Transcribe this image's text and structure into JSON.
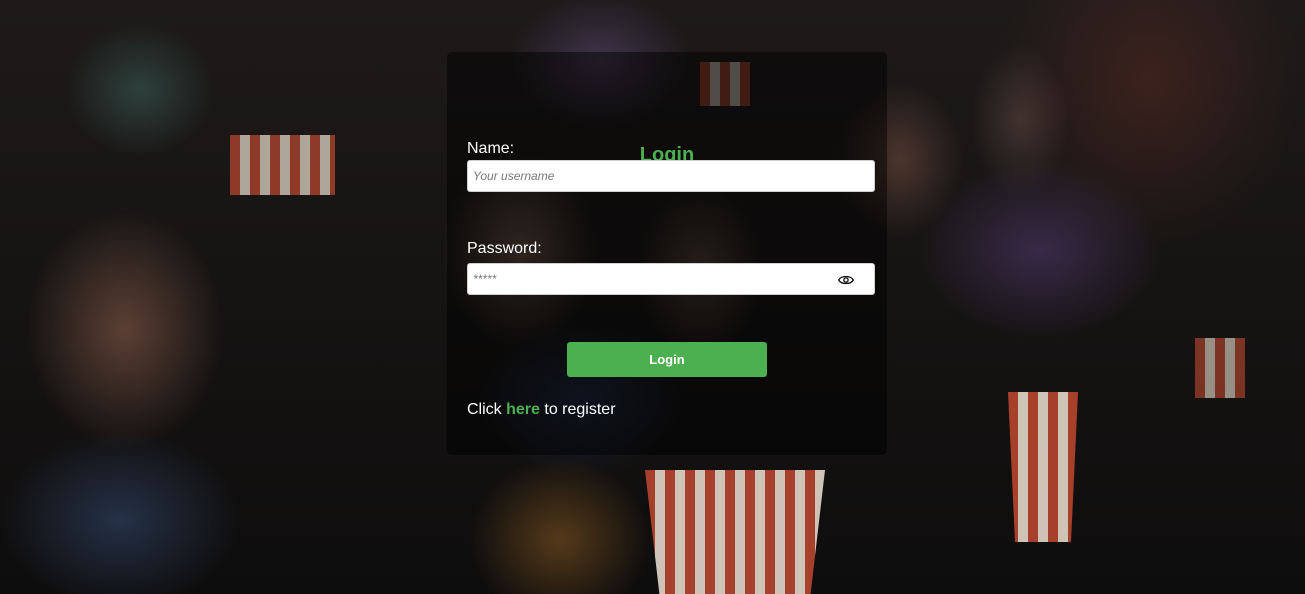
{
  "login": {
    "title": "Login",
    "name_label": "Name:",
    "name_placeholder": "Your username",
    "password_label": "Password:",
    "password_placeholder": "*****",
    "button_label": "Login",
    "register_prefix": "Click",
    "register_link": "here",
    "register_suffix": "to register"
  },
  "icons": {
    "password_toggle": "eye-icon"
  },
  "colors": {
    "accent": "#4caf50",
    "text": "#ffffff",
    "panel_bg": "rgba(0,0,0,0.48)"
  }
}
